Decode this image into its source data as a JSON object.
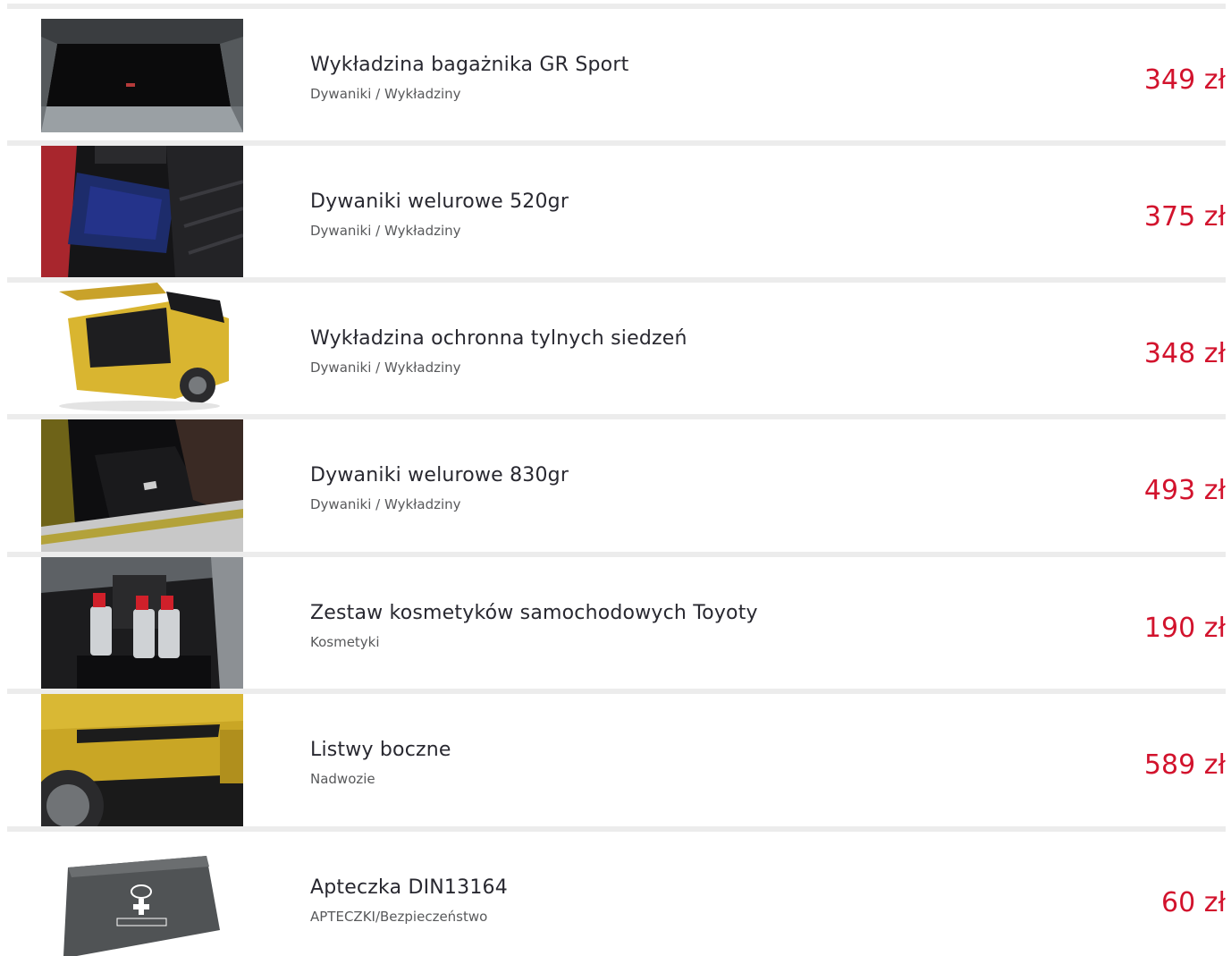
{
  "colors": {
    "price": "#d2132d",
    "divider": "#ececec",
    "title": "#282830",
    "category": "#58595b"
  },
  "products": [
    {
      "name": "Wykładzina bagażnika GR Sport",
      "category": "Dywaniki / Wykładziny",
      "price": "349 zł",
      "image_icon": "trunk-mat-image"
    },
    {
      "name": "Dywaniki welurowe 520gr",
      "category": "Dywaniki / Wykładziny",
      "price": "375 zł",
      "image_icon": "floor-mats-image"
    },
    {
      "name": "Wykładzina ochronna tylnych siedzeń",
      "category": "Dywaniki / Wykładziny",
      "price": "348 zł",
      "image_icon": "rear-seat-liner-image"
    },
    {
      "name": "Dywaniki welurowe 830gr",
      "category": "Dywaniki / Wykładziny",
      "price": "493 zł",
      "image_icon": "velour-mats-image"
    },
    {
      "name": "Zestaw kosmetyków samochodowych Toyoty",
      "category": "Kosmetyki",
      "price": "190 zł",
      "image_icon": "car-cosmetics-image"
    },
    {
      "name": "Listwy boczne",
      "category": "Nadwozie",
      "price": "589 zł",
      "image_icon": "side-mouldings-image"
    },
    {
      "name": "Apteczka DIN13164",
      "category": "APTECZKI/Bezpieczeństwo",
      "price": "60 zł",
      "image_icon": "first-aid-kit-image"
    }
  ]
}
